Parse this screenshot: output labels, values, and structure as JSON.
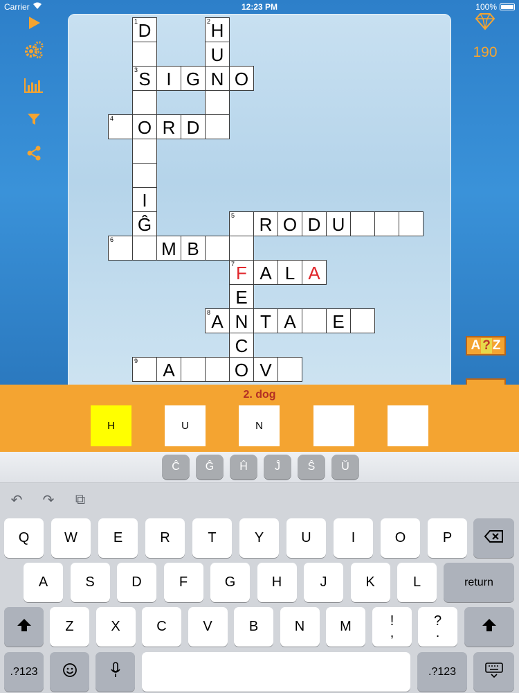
{
  "status_bar": {
    "carrier": "Carrier",
    "time": "12:23 PM",
    "battery": "100%"
  },
  "toolbar": {
    "items": [
      {
        "icon": "play-icon"
      },
      {
        "icon": "gears-icon"
      },
      {
        "icon": "bar-chart-icon"
      },
      {
        "icon": "filter-icon"
      },
      {
        "icon": "share-icon"
      }
    ]
  },
  "score": {
    "icon": "gem-icon",
    "value": "190"
  },
  "hint_button": {
    "a": "A",
    "q": "?",
    "z": "Z"
  },
  "board": {
    "cells": [
      {
        "r": 0,
        "c": 1,
        "n": "1",
        "ch": "D"
      },
      {
        "r": 0,
        "c": 4,
        "n": "2",
        "ch": "H"
      },
      {
        "r": 1,
        "c": 1,
        "ch": ""
      },
      {
        "r": 1,
        "c": 4,
        "ch": "U"
      },
      {
        "r": 2,
        "c": 1,
        "n": "3",
        "ch": "S"
      },
      {
        "r": 2,
        "c": 2,
        "ch": "I"
      },
      {
        "r": 2,
        "c": 3,
        "ch": "G"
      },
      {
        "r": 2,
        "c": 4,
        "ch": "N"
      },
      {
        "r": 2,
        "c": 5,
        "ch": "O"
      },
      {
        "r": 3,
        "c": 1,
        "ch": ""
      },
      {
        "r": 3,
        "c": 4,
        "ch": ""
      },
      {
        "r": 4,
        "c": 0,
        "n": "4",
        "ch": ""
      },
      {
        "r": 4,
        "c": 1,
        "ch": "O"
      },
      {
        "r": 4,
        "c": 2,
        "ch": "R"
      },
      {
        "r": 4,
        "c": 3,
        "ch": "D"
      },
      {
        "r": 4,
        "c": 4,
        "ch": ""
      },
      {
        "r": 5,
        "c": 1,
        "ch": ""
      },
      {
        "r": 6,
        "c": 1,
        "ch": ""
      },
      {
        "r": 7,
        "c": 1,
        "ch": "I"
      },
      {
        "r": 8,
        "c": 1,
        "ch": "Ĝ"
      },
      {
        "r": 8,
        "c": 5,
        "n": "5",
        "ch": ""
      },
      {
        "r": 8,
        "c": 6,
        "ch": "R"
      },
      {
        "r": 8,
        "c": 7,
        "ch": "O"
      },
      {
        "r": 8,
        "c": 8,
        "ch": "D"
      },
      {
        "r": 8,
        "c": 9,
        "ch": "U"
      },
      {
        "r": 8,
        "c": 10,
        "ch": ""
      },
      {
        "r": 8,
        "c": 11,
        "ch": ""
      },
      {
        "r": 8,
        "c": 12,
        "ch": ""
      },
      {
        "r": 9,
        "c": 0,
        "n": "6",
        "ch": ""
      },
      {
        "r": 9,
        "c": 1,
        "ch": ""
      },
      {
        "r": 9,
        "c": 2,
        "ch": "M"
      },
      {
        "r": 9,
        "c": 3,
        "ch": "B"
      },
      {
        "r": 9,
        "c": 4,
        "ch": ""
      },
      {
        "r": 9,
        "c": 5,
        "ch": ""
      },
      {
        "r": 10,
        "c": 5,
        "n": "7",
        "ch": "F",
        "red": true
      },
      {
        "r": 10,
        "c": 6,
        "ch": "A"
      },
      {
        "r": 10,
        "c": 7,
        "ch": "L"
      },
      {
        "r": 10,
        "c": 8,
        "ch": "A",
        "red": true
      },
      {
        "r": 11,
        "c": 5,
        "ch": "E"
      },
      {
        "r": 12,
        "c": 4,
        "n": "8",
        "ch": "A"
      },
      {
        "r": 12,
        "c": 5,
        "ch": "N"
      },
      {
        "r": 12,
        "c": 6,
        "ch": "T"
      },
      {
        "r": 12,
        "c": 7,
        "ch": "A"
      },
      {
        "r": 12,
        "c": 8,
        "ch": ""
      },
      {
        "r": 12,
        "c": 9,
        "ch": "E"
      },
      {
        "r": 12,
        "c": 10,
        "ch": ""
      },
      {
        "r": 13,
        "c": 5,
        "ch": "C"
      },
      {
        "r": 14,
        "c": 1,
        "n": "9",
        "ch": ""
      },
      {
        "r": 14,
        "c": 2,
        "ch": "A"
      },
      {
        "r": 14,
        "c": 3,
        "ch": ""
      },
      {
        "r": 14,
        "c": 4,
        "ch": ""
      },
      {
        "r": 14,
        "c": 5,
        "ch": "O"
      },
      {
        "r": 14,
        "c": 6,
        "ch": "V"
      },
      {
        "r": 14,
        "c": 7,
        "ch": ""
      }
    ]
  },
  "clue": {
    "text": "2. dog",
    "letters": [
      "H",
      "U",
      "N",
      "",
      ""
    ],
    "selected_index": 0
  },
  "accent_keys": [
    "Ĉ",
    "Ĝ",
    "Ĥ",
    "Ĵ",
    "Ŝ",
    "Ŭ"
  ],
  "keyboard": {
    "toolbar": [
      {
        "icon": "undo-icon",
        "glyph": "↶"
      },
      {
        "icon": "redo-icon",
        "glyph": "↷"
      },
      {
        "icon": "paste-icon",
        "glyph": "⧉"
      }
    ],
    "row1": [
      "Q",
      "W",
      "E",
      "R",
      "T",
      "Y",
      "U",
      "I",
      "O",
      "P"
    ],
    "row2": [
      "A",
      "S",
      "D",
      "F",
      "G",
      "H",
      "J",
      "K",
      "L"
    ],
    "row3": [
      "Z",
      "X",
      "C",
      "V",
      "B",
      "N",
      "M"
    ],
    "row3_punct": [
      "!\n,",
      "?\n."
    ],
    "return_label": "return",
    "numbers_label": ".?123",
    "backspace_icon": "backspace-icon",
    "shift_icon": "shift-icon",
    "emoji_icon": "emoji-icon",
    "mic_icon": "microphone-icon",
    "hide_icon": "keyboard-hide-icon"
  }
}
